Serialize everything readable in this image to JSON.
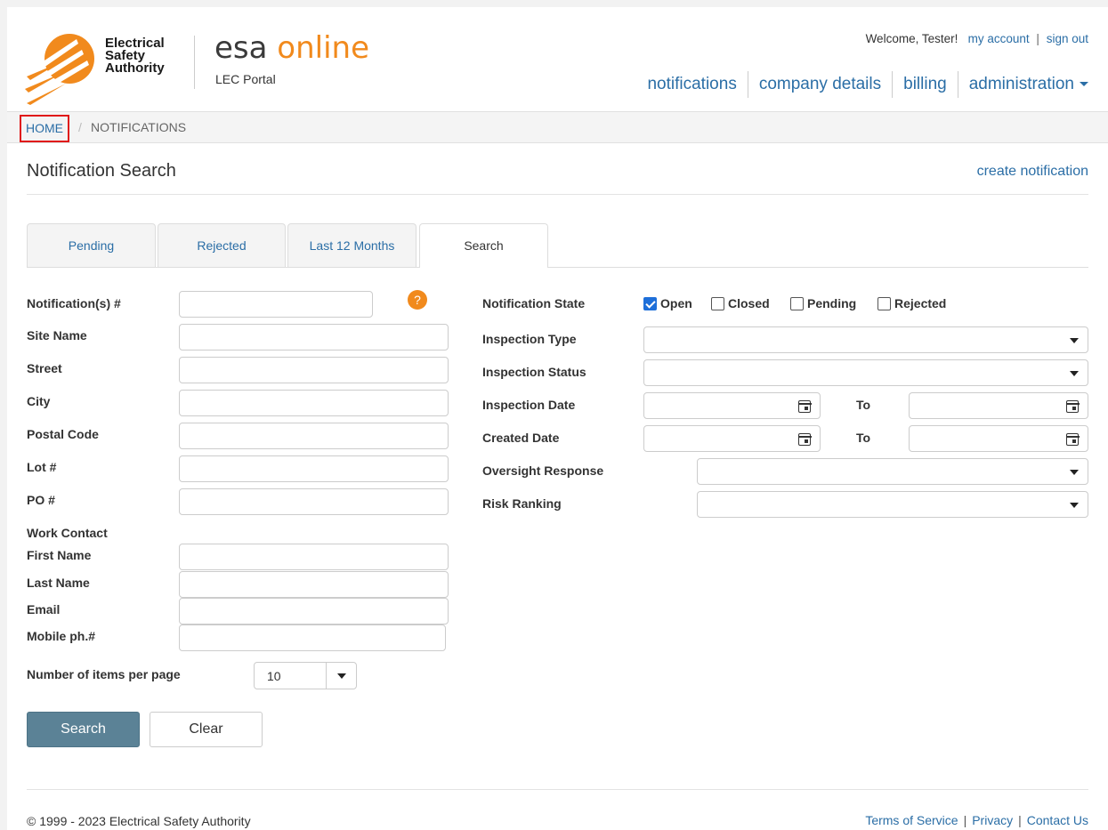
{
  "brand": {
    "org_line1": "Electrical",
    "org_line2": "Safety",
    "org_line3": "Authority",
    "app_name_part1": "esa ",
    "app_name_part2": "online",
    "portal": "LEC Portal",
    "accent_color": "#f18a1d"
  },
  "account": {
    "welcome": "Welcome, Tester!",
    "my_account": "my account",
    "sep": "|",
    "sign_out": "sign out"
  },
  "nav": {
    "notifications": "notifications",
    "company_details": "company details",
    "billing": "billing",
    "administration": "administration"
  },
  "breadcrumb": {
    "home": "HOME",
    "sep": "/",
    "current": "NOTIFICATIONS"
  },
  "page": {
    "title": "Notification Search",
    "create_link": "create notification"
  },
  "tabs": {
    "pending": "Pending",
    "rejected": "Rejected",
    "last12": "Last 12 Months",
    "search": "Search"
  },
  "left_form": {
    "notification_num": "Notification(s) #",
    "help": "?",
    "site_name": "Site Name",
    "street": "Street",
    "city": "City",
    "postal_code": "Postal Code",
    "lot": "Lot #",
    "po": "PO #",
    "work_contact": "Work Contact",
    "first_name": "First Name",
    "last_name": "Last Name",
    "email": "Email",
    "mobile": "Mobile ph.#",
    "items_per_page": "Number of items per page",
    "items_per_page_value": "10"
  },
  "right_form": {
    "notification_state": "Notification State",
    "state_open": "Open",
    "state_closed": "Closed",
    "state_pending": "Pending",
    "state_rejected": "Rejected",
    "inspection_type": "Inspection Type",
    "inspection_status": "Inspection Status",
    "inspection_date": "Inspection Date",
    "created_date": "Created Date",
    "to": "To",
    "oversight_response": "Oversight Response",
    "risk_ranking": "Risk Ranking"
  },
  "buttons": {
    "search": "Search",
    "clear": "Clear"
  },
  "footer": {
    "copyright": "© 1999 - 2023 Electrical Safety Authority",
    "terms": "Terms of Service",
    "privacy": "Privacy",
    "contact": "Contact Us",
    "sep": "|"
  }
}
